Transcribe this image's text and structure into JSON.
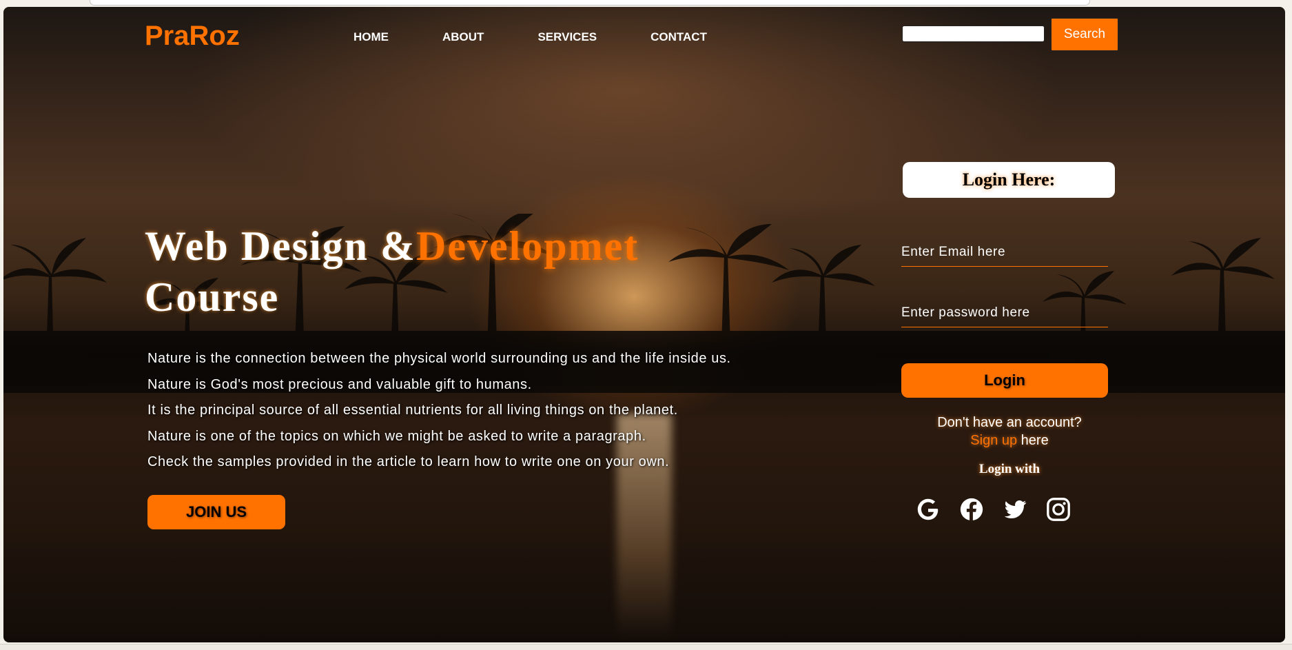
{
  "header": {
    "logo": "PraRoz",
    "nav": [
      "HOME",
      "ABOUT",
      "SERVICES",
      "CONTACT"
    ],
    "search": {
      "value": "",
      "button_label": "Search"
    }
  },
  "hero": {
    "title_main": "Web Design &",
    "title_accent": "Developmet",
    "title_end": "Course",
    "paragraphs": [
      "Nature is the connection between the physical world surrounding us and the life inside us.",
      "Nature is God's most precious and valuable gift to humans.",
      "It is the principal source of all essential nutrients for all living things on the planet.",
      "Nature is one of the topics on which we might be asked to write a paragraph.",
      "Check the samples provided in the article to learn how to write one on your own."
    ],
    "join_button": "JOIN US"
  },
  "login": {
    "heading": "Login Here:",
    "email_placeholder": "Enter Email here",
    "password_placeholder": "Enter password here",
    "button_label": "Login",
    "no_account": "Don't have an account?",
    "signup_link": "Sign up",
    "signup_suffix": " here",
    "login_with": "Login with",
    "social": [
      "google-icon",
      "facebook-icon",
      "twitter-icon",
      "instagram-icon"
    ]
  },
  "colors": {
    "accent": "#ff7200",
    "text": "#ffffff"
  }
}
